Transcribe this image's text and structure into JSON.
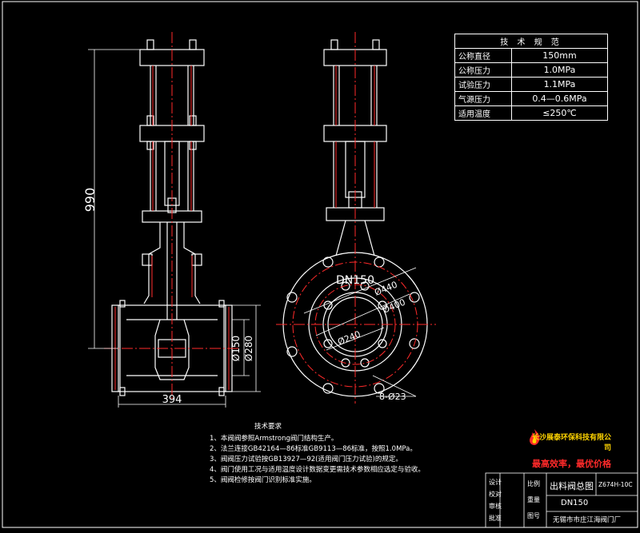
{
  "drawing": {
    "dims": {
      "height": "990",
      "length": "394",
      "bore_small": "Ø150",
      "bore_large": "Ø280",
      "dn": "DN150",
      "circle_440": "Ø440",
      "circle_400": "Ø400",
      "circle_240": "Ø240",
      "holes": "8-Ø23"
    }
  },
  "spec": {
    "title": "技 术 规 范",
    "rows": [
      {
        "key": "公称直径",
        "value": "150mm"
      },
      {
        "key": "公称压力",
        "value": "1.0MPa"
      },
      {
        "key": "试验压力",
        "value": "1.1MPa"
      },
      {
        "key": "气源压力",
        "value": "0.4—0.6MPa"
      },
      {
        "key": "适用温度",
        "value": "≤250℃"
      }
    ]
  },
  "notes": {
    "heading": "技术要求",
    "items": [
      "1、本阀阀参照Armstrong阀门结构生产。",
      "2、法兰连接GB42164—86标准GB9113—86标准，按照1.0MPa。",
      "3、阀阀压力试验按GB13927—92(适用阀门压力试验)的规定。",
      "4、阀门使用工况与适用温度设计数据变更需技术参数相应选定与验收。",
      "5、阀阀检修按阀门识别标准实施。"
    ]
  },
  "brand": {
    "name": "长沙展泰环保科技有限公司",
    "slogan": "最高效率，最优价格"
  },
  "title_block": {
    "drawing_name": "出料阀总图",
    "code": "Z674H-10C",
    "size": "DN150",
    "factory": "无锡市市庄江海阀门厂",
    "left_labels": [
      "设计",
      "校对",
      "审核",
      "批准"
    ],
    "mid_labels": [
      "比例",
      "重量",
      "图号"
    ]
  },
  "colors": {
    "line": "#ffffff",
    "center": "#ff2a2a",
    "accent": "#ffd400"
  }
}
